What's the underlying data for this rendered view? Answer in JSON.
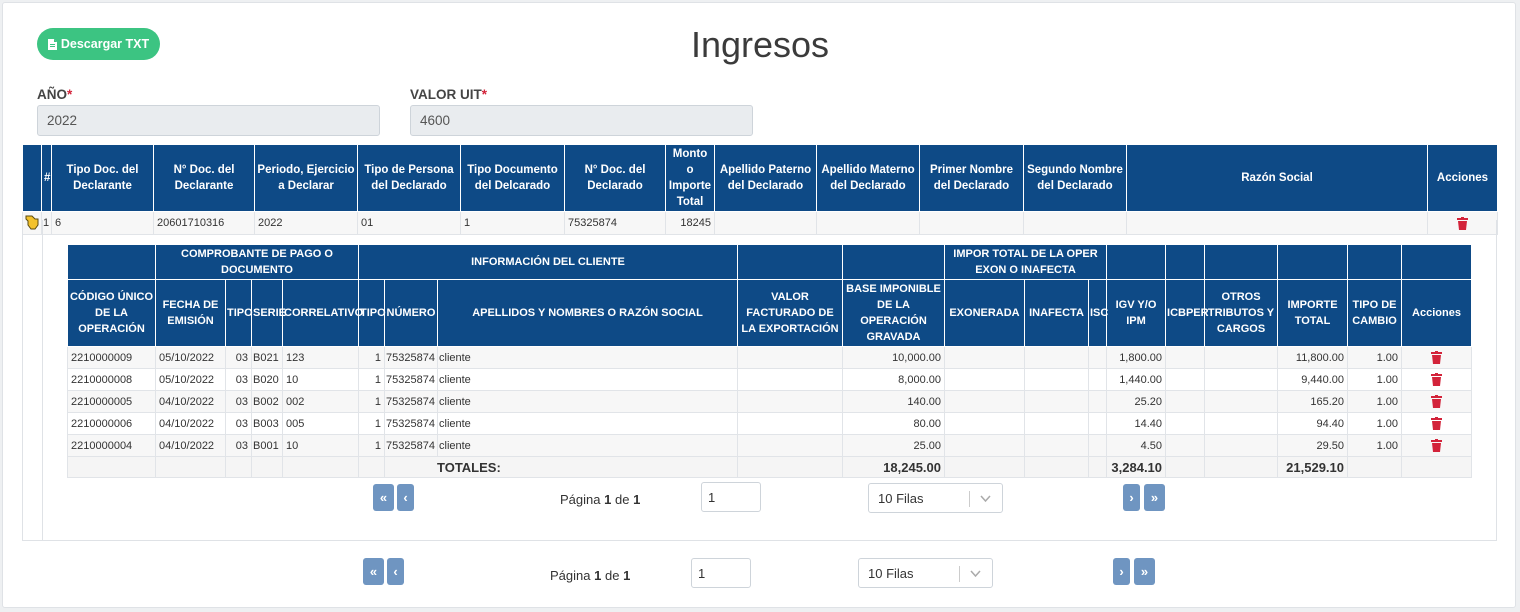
{
  "download_button": {
    "label": "Descargar TXT"
  },
  "page_title": "Ingresos",
  "fields": {
    "year": {
      "label": "AÑO",
      "required": "*",
      "value": "2022"
    },
    "uit": {
      "label": "VALOR UIT",
      "required": "*",
      "value": "4600"
    }
  },
  "main_table": {
    "headers": [
      "#",
      "Tipo Doc. del Declarante",
      "N° Doc. del Declarante",
      "Periodo, Ejercicio a Declarar",
      "Tipo de Persona del Declarado",
      "Tipo Documento del Delcarado",
      "N° Doc. del Declarado",
      "Monto o Importe Total",
      "Apellido Paterno del Declarado",
      "Apellido Materno del Declarado",
      "Primer Nombre del Declarado",
      "Segundo Nombre del Declarado",
      "Razón Social",
      "Acciones"
    ],
    "row": {
      "index": "1",
      "tipo_doc": "6",
      "num_doc": "20601710316",
      "periodo": "2022",
      "tipo_persona": "01",
      "tipo_documento": "1",
      "num_doc_declarado": "75325874",
      "monto": "18245",
      "ap_paterno": "",
      "ap_materno": "",
      "primer_nombre": "",
      "segundo_nombre": "",
      "razon_social": ""
    }
  },
  "detail_table": {
    "group_headers": {
      "comprobante": "COMPROBANTE DE PAGO O DOCUMENTO",
      "cliente": "INFORMACIÓN DEL CLIENTE",
      "impor_total": "IMPOR TOTAL DE LA OPER EXON O INAFECTA"
    },
    "headers": [
      "CÓDIGO ÚNICO DE LA OPERACIÓN",
      "FECHA DE EMISIÓN",
      "TIPO",
      "SERIE",
      "CORRELATIVO",
      "TIPO",
      "NÚMERO",
      "APELLIDOS Y NOMBRES O RAZÓN SOCIAL",
      "VALOR FACTURADO DE LA EXPORTACIÓN",
      "BASE IMPONIBLE DE LA OPERACIÓN GRAVADA",
      "EXONERADA",
      "INAFECTA",
      "ISC",
      "IGV Y/O IPM",
      "ICBPER",
      "OTROS TRIBUTOS Y CARGOS",
      "IMPORTE TOTAL",
      "TIPO DE CAMBIO",
      "Acciones"
    ],
    "rows": [
      {
        "codigo": "2210000009",
        "fecha": "05/10/2022",
        "tipo": "03",
        "serie": "B021",
        "correlativo": "123",
        "tipo_cli": "1",
        "numero": "75325874",
        "nombre": "cliente",
        "valor_exp": "",
        "base": "10,000.00",
        "exonerada": "",
        "inafecta": "",
        "isc": "",
        "igv": "1,800.00",
        "icbper": "",
        "otros": "",
        "importe": "11,800.00",
        "cambio": "1.00"
      },
      {
        "codigo": "2210000008",
        "fecha": "05/10/2022",
        "tipo": "03",
        "serie": "B020",
        "correlativo": "10",
        "tipo_cli": "1",
        "numero": "75325874",
        "nombre": "cliente",
        "valor_exp": "",
        "base": "8,000.00",
        "exonerada": "",
        "inafecta": "",
        "isc": "",
        "igv": "1,440.00",
        "icbper": "",
        "otros": "",
        "importe": "9,440.00",
        "cambio": "1.00"
      },
      {
        "codigo": "2210000005",
        "fecha": "04/10/2022",
        "tipo": "03",
        "serie": "B002",
        "correlativo": "002",
        "tipo_cli": "1",
        "numero": "75325874",
        "nombre": "cliente",
        "valor_exp": "",
        "base": "140.00",
        "exonerada": "",
        "inafecta": "",
        "isc": "",
        "igv": "25.20",
        "icbper": "",
        "otros": "",
        "importe": "165.20",
        "cambio": "1.00"
      },
      {
        "codigo": "2210000006",
        "fecha": "04/10/2022",
        "tipo": "03",
        "serie": "B003",
        "correlativo": "005",
        "tipo_cli": "1",
        "numero": "75325874",
        "nombre": "cliente",
        "valor_exp": "",
        "base": "80.00",
        "exonerada": "",
        "inafecta": "",
        "isc": "",
        "igv": "14.40",
        "icbper": "",
        "otros": "",
        "importe": "94.40",
        "cambio": "1.00"
      },
      {
        "codigo": "2210000004",
        "fecha": "04/10/2022",
        "tipo": "03",
        "serie": "B001",
        "correlativo": "10",
        "tipo_cli": "1",
        "numero": "75325874",
        "nombre": "cliente",
        "valor_exp": "",
        "base": "25.00",
        "exonerada": "",
        "inafecta": "",
        "isc": "",
        "igv": "4.50",
        "icbper": "",
        "otros": "",
        "importe": "29.50",
        "cambio": "1.00"
      }
    ],
    "totals": {
      "label": "TOTALES:",
      "base": "18,245.00",
      "igv": "3,284.10",
      "importe": "21,529.10"
    }
  },
  "inner_pager": {
    "page_word": "Página",
    "current": "1",
    "of_word": "de",
    "total": "1",
    "input_value": "1",
    "rows_select": "10 Filas"
  },
  "outer_pager": {
    "page_word": "Página",
    "current": "1",
    "of_word": "de",
    "total": "1",
    "input_value": "1",
    "rows_select": "10 Filas"
  },
  "colors": {
    "header_bg": "#0e4a86",
    "success": "#3cc482",
    "danger": "#d3233a",
    "pager_btn": "#6f95c1"
  }
}
